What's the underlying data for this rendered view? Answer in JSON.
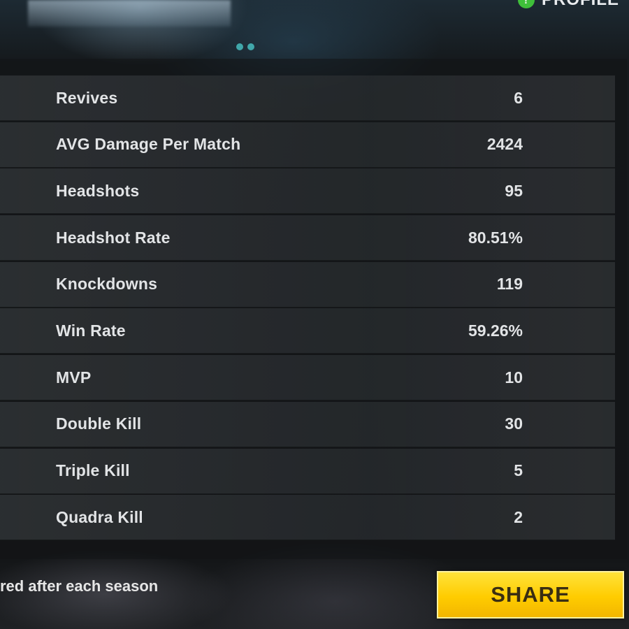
{
  "header": {
    "profile_tab_label": "PROFILE",
    "profile_icon_glyph": "!"
  },
  "stats": [
    {
      "label": "Revives",
      "value": "6"
    },
    {
      "label": "AVG Damage Per Match",
      "value": "2424"
    },
    {
      "label": "Headshots",
      "value": "95"
    },
    {
      "label": "Headshot Rate",
      "value": "80.51%"
    },
    {
      "label": "Knockdowns",
      "value": "119"
    },
    {
      "label": "Win Rate",
      "value": "59.26%"
    },
    {
      "label": "MVP",
      "value": "10"
    },
    {
      "label": "Double Kill",
      "value": "30"
    },
    {
      "label": "Triple Kill",
      "value": "5"
    },
    {
      "label": "Quadra Kill",
      "value": "2"
    }
  ],
  "footer": {
    "note": "red after each season",
    "share_label": "SHARE"
  },
  "colors": {
    "accent_yellow": "#ffcc00",
    "profile_green": "#3fbf3a"
  }
}
